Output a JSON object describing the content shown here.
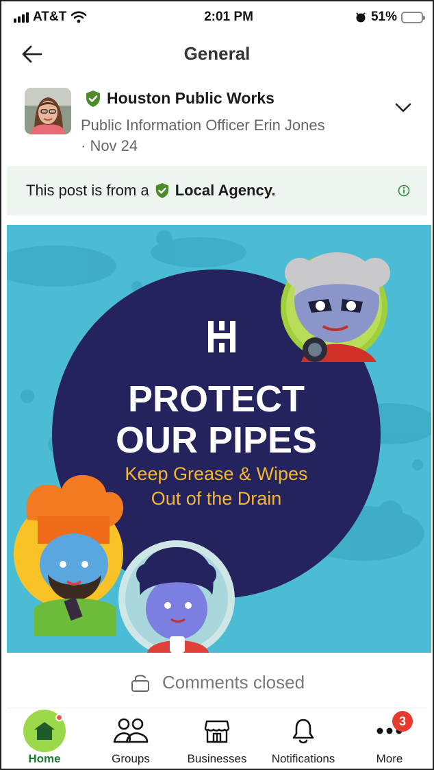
{
  "status_bar": {
    "carrier": "AT&T",
    "time": "2:01 PM",
    "battery": "51%",
    "battery_level": 0.51
  },
  "header": {
    "title": "General",
    "back_icon": "arrow-left-icon"
  },
  "author": {
    "name": "Houston Public Works",
    "subtitle": "Public Information Officer Erin Jones",
    "date": "· Nov 24",
    "verified_icon": "green-shield-check-icon",
    "menu_icon": "chevron-down-icon"
  },
  "agency_banner": {
    "prefix": "This post is from a",
    "label": "Local Agency.",
    "info_icon": "info-icon",
    "bg": "#eef5ef"
  },
  "post_image": {
    "logo": "H",
    "line1": "PROTECT",
    "line2": "OUR PIPES",
    "line3": "Keep Grease & Wipes",
    "line4": "Out of the Drain",
    "bg": "#4bbcd3",
    "circle": "#24235e",
    "accent": "#f5b731"
  },
  "comments": {
    "label": "Comments closed",
    "icon": "lock-icon"
  },
  "tabs": [
    {
      "label": "Home",
      "icon": "home-icon",
      "active": true
    },
    {
      "label": "Groups",
      "icon": "groups-icon"
    },
    {
      "label": "Businesses",
      "icon": "storefront-icon"
    },
    {
      "label": "Notifications",
      "icon": "bell-icon"
    },
    {
      "label": "More",
      "icon": "more-dots-icon",
      "badge": "3"
    }
  ],
  "colors": {
    "accent_green": "#1a7a2e",
    "home_bubble": "#9bd84a",
    "badge_red": "#e63a2e"
  }
}
